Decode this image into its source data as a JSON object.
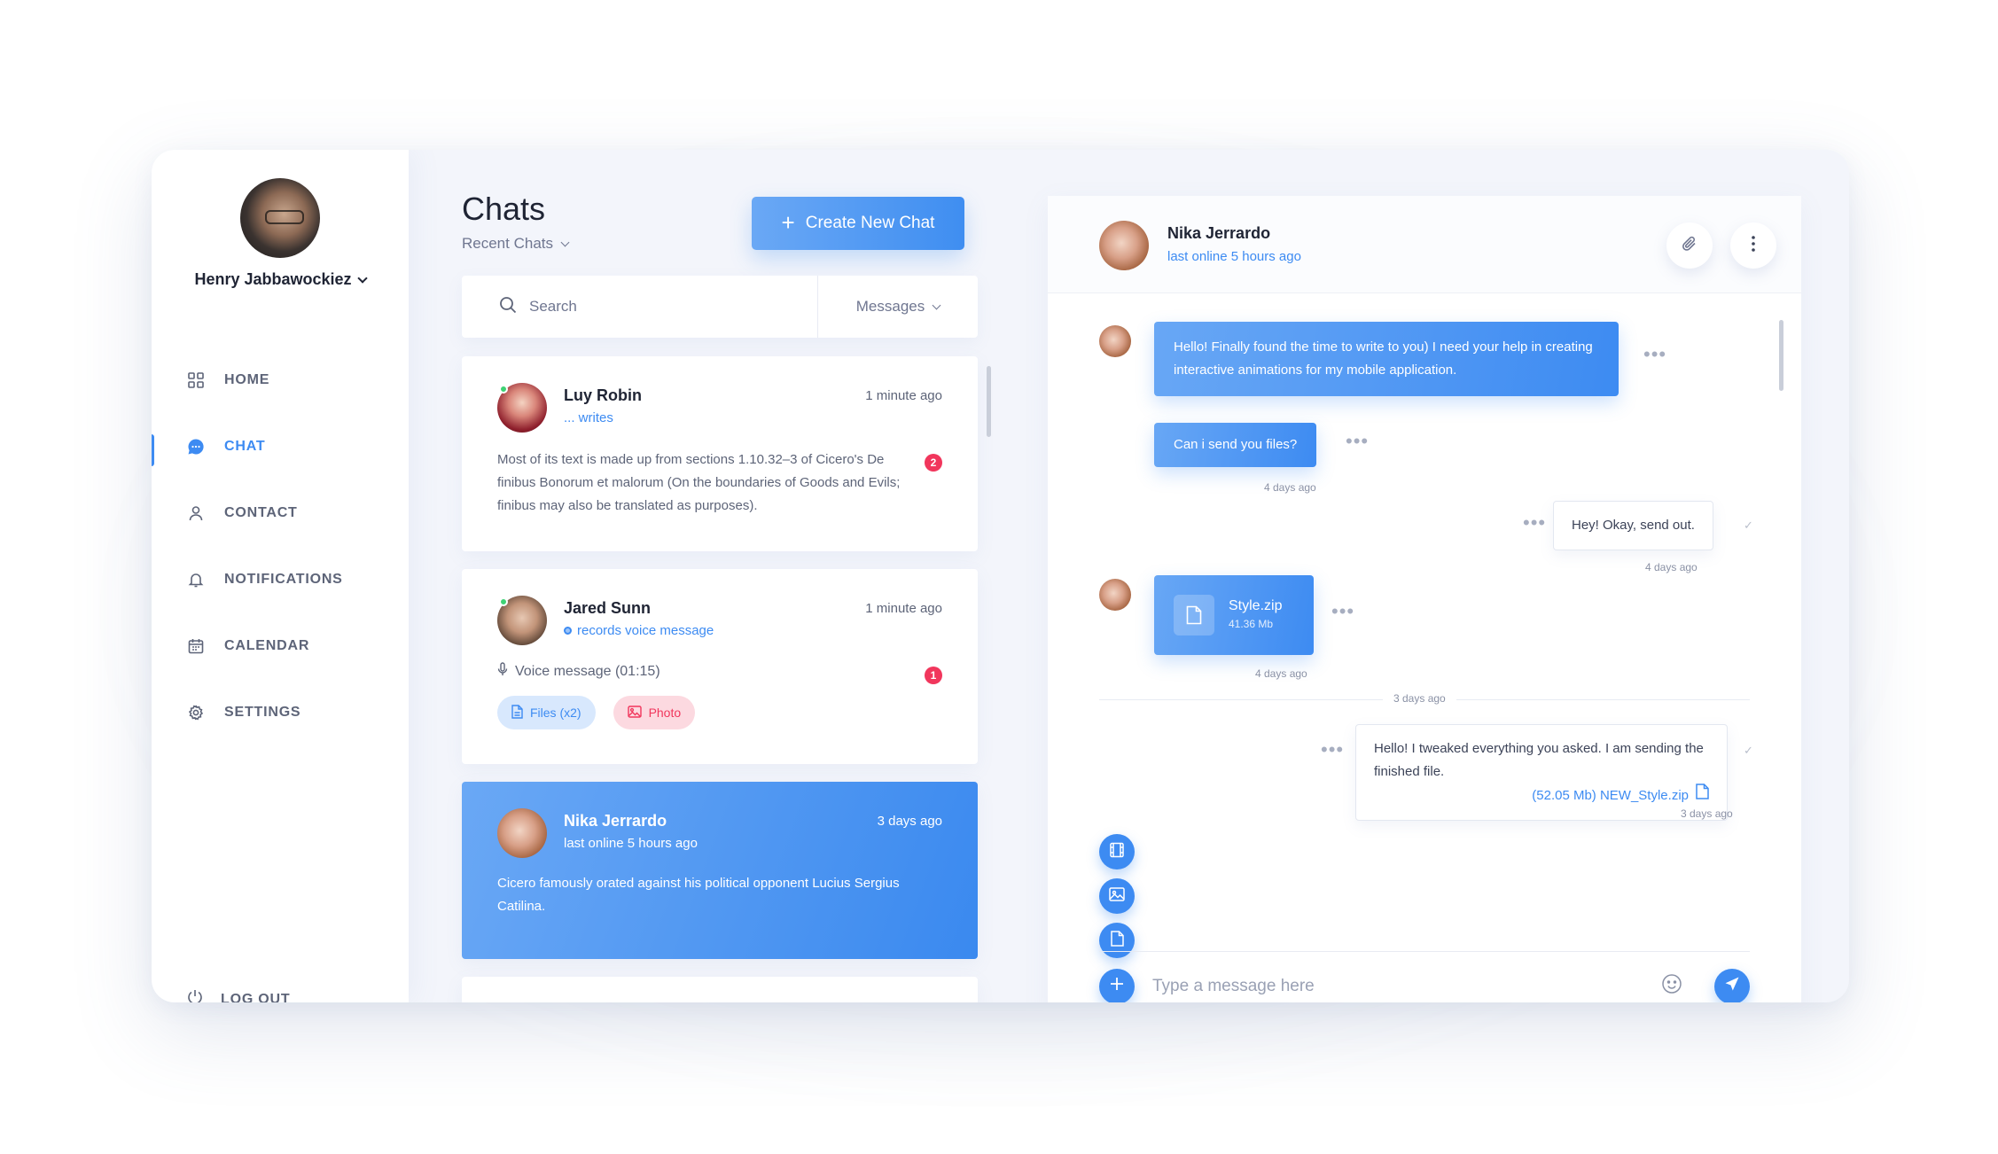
{
  "user": {
    "name": "Henry Jabbawockiez"
  },
  "nav": {
    "items": [
      {
        "label": "HOME",
        "icon": "grid-icon"
      },
      {
        "label": "CHAT",
        "icon": "chat-bubble-icon",
        "active": true
      },
      {
        "label": "CONTACT",
        "icon": "person-icon"
      },
      {
        "label": "NOTIFICATIONS",
        "icon": "bell-icon"
      },
      {
        "label": "CALENDAR",
        "icon": "calendar-icon"
      },
      {
        "label": "SETTINGS",
        "icon": "gear-icon"
      }
    ],
    "logout": "LOG OUT"
  },
  "chats": {
    "title": "Chats",
    "filter": "Recent Chats",
    "create_button": "Create New Chat",
    "search_placeholder": "Search",
    "type_select": "Messages",
    "list": [
      {
        "name": "Luy Robin",
        "status": "... writes",
        "time": "1 minute ago",
        "preview": "Most of its text is made up from sections 1.10.32–3 of Cicero's De finibus Bonorum et malorum (On the boundaries of Goods and Evils; finibus may also be translated as purposes).",
        "unread": "2"
      },
      {
        "name": "Jared Sunn",
        "status": "records voice message",
        "time": "1 minute ago",
        "voice": "Voice message (01:15)",
        "unread": "1",
        "chips": [
          "Files (x2)",
          "Photo"
        ]
      },
      {
        "name": "Nika Jerrardo",
        "status": "last online 5 hours ago",
        "time": "3 days ago",
        "preview": "Cicero famously orated against his political opponent Lucius Sergius Catilina."
      }
    ]
  },
  "conversation": {
    "name": "Nika Jerrardo",
    "status": "last online 5 hours ago",
    "messages": [
      {
        "dir": "in",
        "text": "Hello! Finally found the time to write to you) I need your help in creating interactive animations for my mobile application."
      },
      {
        "dir": "in",
        "text": "Can i send you files?",
        "time": "4 days ago"
      },
      {
        "dir": "out",
        "text": "Hey! Okay, send out.",
        "time": "4 days ago"
      },
      {
        "dir": "in",
        "file_name": "Style.zip",
        "file_size": "41.36 Mb",
        "time": "4 days ago"
      },
      {
        "dir": "out",
        "text": "Hello! I tweaked everything you asked. I am sending the finished file.",
        "attachment": "(52.05 Mb) NEW_Style.zip",
        "time": "3 days ago"
      }
    ],
    "divider": "3 days ago",
    "composer_placeholder": "Type a message here"
  },
  "colors": {
    "accent": "#3d8bf2",
    "badge": "#f1365c",
    "online": "#3ed274"
  }
}
